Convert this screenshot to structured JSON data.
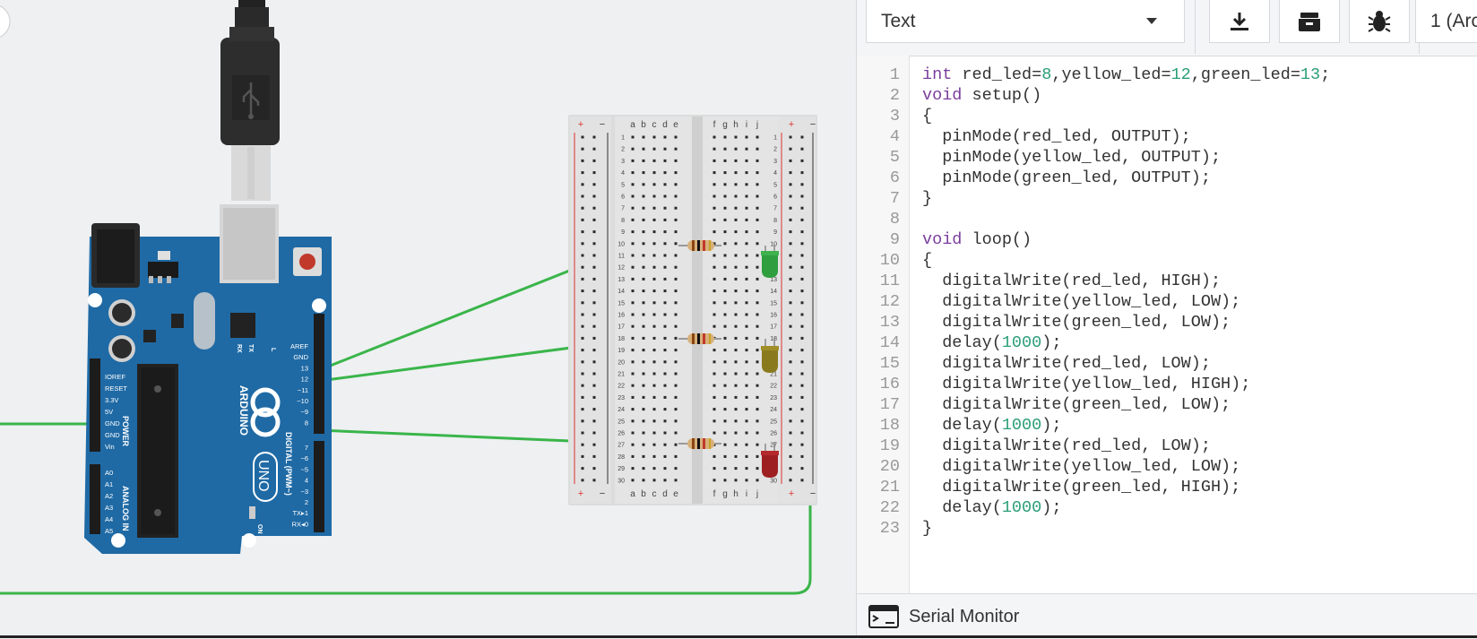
{
  "editor_mode": "Text",
  "board_selector": "1 (Arc",
  "serial_monitor_label": "Serial Monitor",
  "icons": [
    "download-icon",
    "library-icon",
    "debug-icon",
    "serial-monitor-icon"
  ],
  "colors": {
    "wire": "#3ab54a",
    "arduino_blue": "#1f6aa5",
    "keyword": "#7a3e9d",
    "number": "#2a9d78"
  },
  "code_lines": [
    [
      [
        "int",
        "kw"
      ],
      [
        " red_led=",
        ""
      ],
      [
        "8",
        "num"
      ],
      [
        ",yellow_led=",
        ""
      ],
      [
        "12",
        "num"
      ],
      [
        ",green_led=",
        ""
      ],
      [
        "13",
        "num"
      ],
      [
        ";",
        ""
      ]
    ],
    [
      [
        "void",
        "kw"
      ],
      [
        " setup()",
        ""
      ]
    ],
    [
      [
        "{",
        ""
      ]
    ],
    [
      [
        "  pinMode(red_led, OUTPUT);",
        ""
      ]
    ],
    [
      [
        "  pinMode(yellow_led, OUTPUT);",
        ""
      ]
    ],
    [
      [
        "  pinMode(green_led, OUTPUT);",
        ""
      ]
    ],
    [
      [
        "}",
        ""
      ]
    ],
    [],
    [
      [
        "void",
        "kw"
      ],
      [
        " loop()",
        ""
      ]
    ],
    [
      [
        "{",
        ""
      ]
    ],
    [
      [
        "  digitalWrite(red_led, HIGH);",
        ""
      ]
    ],
    [
      [
        "  digitalWrite(yellow_led, LOW);",
        ""
      ]
    ],
    [
      [
        "  digitalWrite(green_led, LOW);",
        ""
      ]
    ],
    [
      [
        "  delay(",
        ""
      ],
      [
        "1000",
        "num"
      ],
      [
        ");",
        ""
      ]
    ],
    [
      [
        "  digitalWrite(red_led, LOW);",
        ""
      ]
    ],
    [
      [
        "  digitalWrite(yellow_led, HIGH);",
        ""
      ]
    ],
    [
      [
        "  digitalWrite(green_led, LOW);",
        ""
      ]
    ],
    [
      [
        "  delay(",
        ""
      ],
      [
        "1000",
        "num"
      ],
      [
        ");",
        ""
      ]
    ],
    [
      [
        "  digitalWrite(red_led, LOW);",
        ""
      ]
    ],
    [
      [
        "  digitalWrite(yellow_led, LOW);",
        ""
      ]
    ],
    [
      [
        "  digitalWrite(green_led, HIGH);",
        ""
      ]
    ],
    [
      [
        "  delay(",
        ""
      ],
      [
        "1000",
        "num"
      ],
      [
        ");",
        ""
      ]
    ],
    [
      [
        "}",
        ""
      ]
    ]
  ],
  "arduino": {
    "brand": "ARDUINO",
    "model": "UNO",
    "on_label": "ON",
    "tx_label": "TX",
    "rx_label": "RX",
    "l_label": "L",
    "power_label": "POWER",
    "analog_label": "ANALOG IN",
    "digital_label": "DIGITAL (PWM~)",
    "power_pins": [
      "IOREF",
      "RESET",
      "3.3V",
      "5V",
      "GND",
      "GND",
      "Vin"
    ],
    "analog_pins": [
      "A0",
      "A1",
      "A2",
      "A3",
      "A4",
      "A5"
    ],
    "digital_top": [
      "AREF",
      "GND",
      "13",
      "12",
      "~11",
      "~10",
      "~9",
      "8"
    ],
    "digital_bottom": [
      "7",
      "~6",
      "~5",
      "4",
      "~3",
      "2",
      "TX▸1",
      "RX◂0"
    ]
  },
  "breadboard": {
    "plus": "+",
    "minus": "−",
    "cols_left": [
      "a",
      "b",
      "c",
      "d",
      "e"
    ],
    "cols_right": [
      "f",
      "g",
      "h",
      "i",
      "j"
    ],
    "rows": [
      "1",
      "2",
      "3",
      "4",
      "5",
      "6",
      "7",
      "8",
      "9",
      "10",
      "11",
      "12",
      "13",
      "14",
      "15",
      "16",
      "17",
      "18",
      "19",
      "20",
      "21",
      "22",
      "23",
      "24",
      "25",
      "26",
      "27",
      "28",
      "29",
      "30"
    ]
  }
}
